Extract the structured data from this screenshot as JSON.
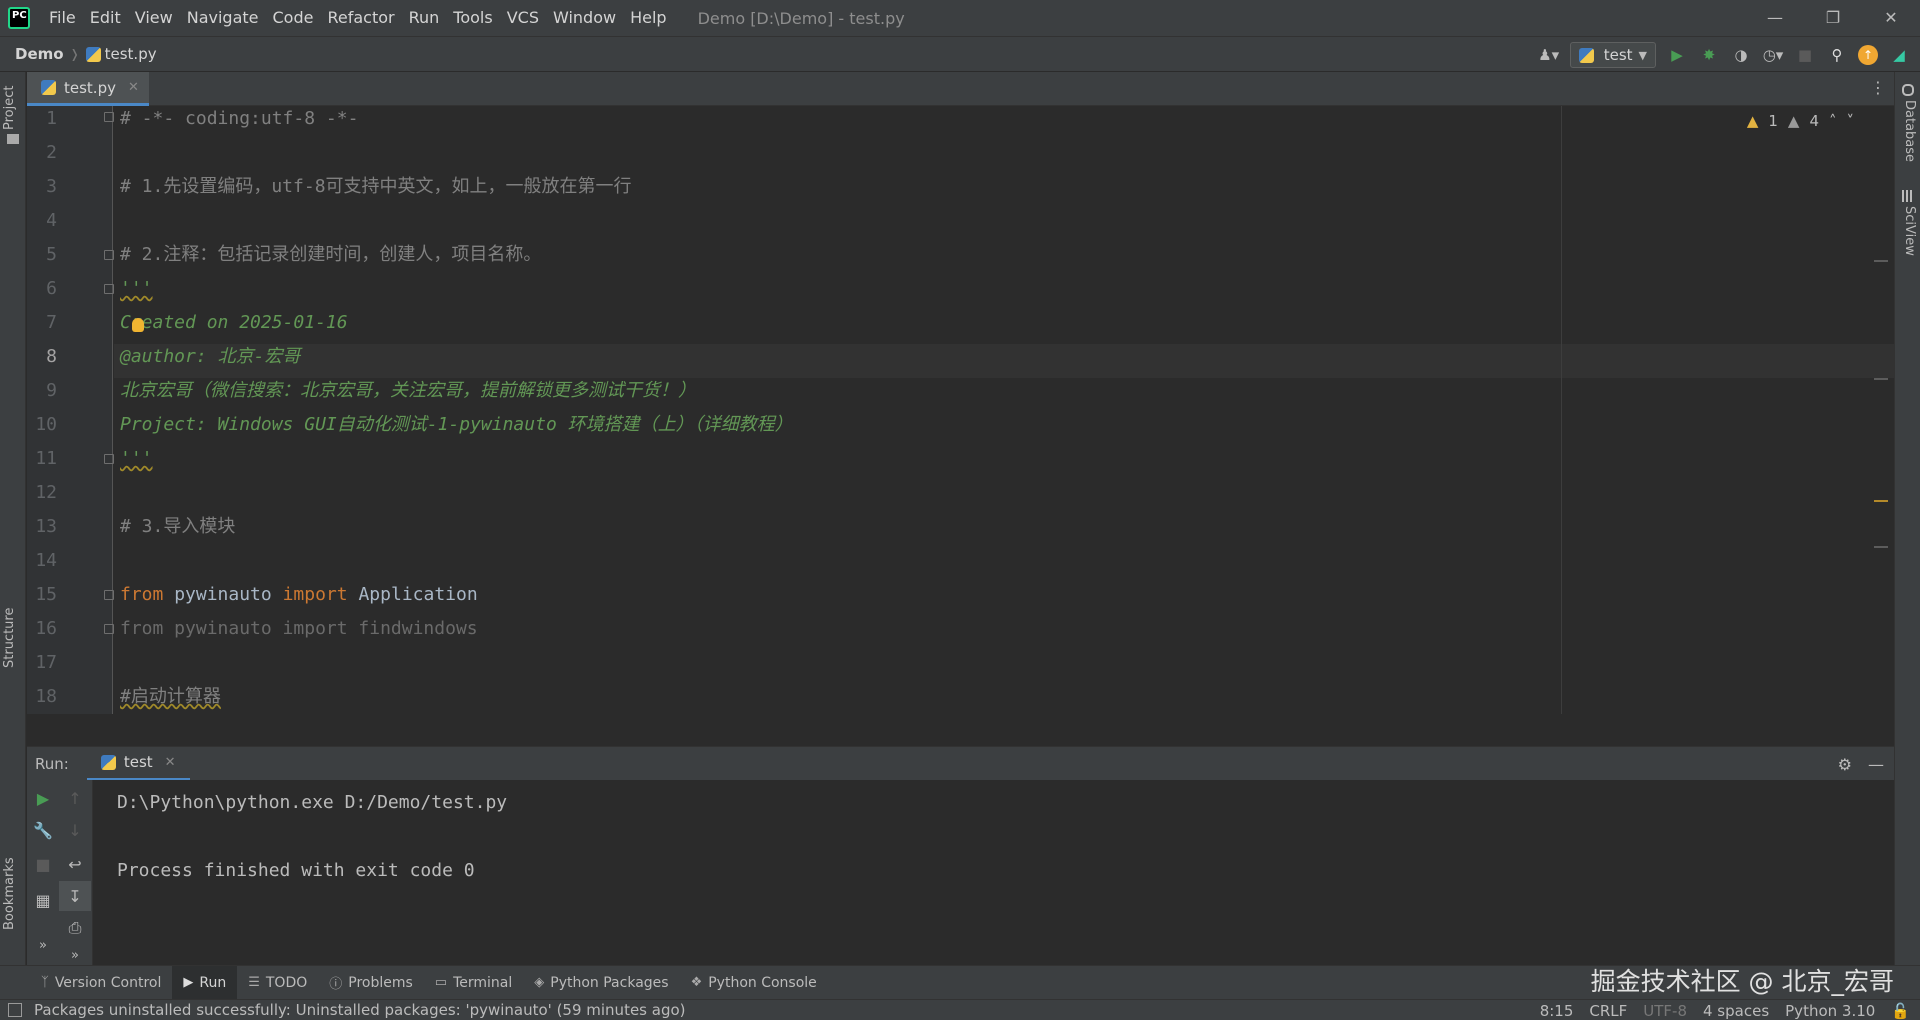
{
  "titlebar": {
    "menu": [
      "File",
      "Edit",
      "View",
      "Navigate",
      "Code",
      "Refactor",
      "Run",
      "Tools",
      "VCS",
      "Window",
      "Help"
    ],
    "window_title": "Demo [D:\\Demo] - test.py"
  },
  "navbar": {
    "project": "Demo",
    "file": "test.py",
    "run_config": "test"
  },
  "left_strip": {
    "project": "Project",
    "structure": "Structure",
    "bookmarks": "Bookmarks"
  },
  "right_strip": {
    "database": "Database",
    "sciview": "SciView"
  },
  "editor_tab": {
    "label": "test.py"
  },
  "inspections": {
    "warnings": "1",
    "weak_warnings": "4"
  },
  "editor": {
    "current_line": 8,
    "lines": [
      {
        "n": "1",
        "text": "# -*- coding:utf-8 -*-"
      },
      {
        "n": "2",
        "text": ""
      },
      {
        "n": "3",
        "text": "# 1.先设置编码，utf-8可支持中英文，如上，一般放在第一行"
      },
      {
        "n": "4",
        "text": ""
      },
      {
        "n": "5",
        "text": "# 2.注释：包括记录创建时间，创建人，项目名称。"
      },
      {
        "n": "6",
        "text": "'''"
      },
      {
        "n": "7",
        "text": "Created on 2025-01-16"
      },
      {
        "n": "8",
        "text": "@author: 北京-宏哥"
      },
      {
        "n": "9",
        "text": "北京宏哥（微信搜索：北京宏哥，关注宏哥，提前解锁更多测试干货！）"
      },
      {
        "n": "10",
        "text": "Project: Windows GUI自动化测试-1-pywinauto 环境搭建（上）（详细教程）"
      },
      {
        "n": "11",
        "text": "'''"
      },
      {
        "n": "12",
        "text": ""
      },
      {
        "n": "13",
        "text": "# 3.导入模块"
      },
      {
        "n": "14",
        "text": ""
      },
      {
        "n": "15",
        "kw1": "from",
        "mod": "pywinauto",
        "kw2": "import",
        "name": "Application"
      },
      {
        "n": "16",
        "text": "from pywinauto import findwindows"
      },
      {
        "n": "17",
        "text": ""
      },
      {
        "n": "18",
        "text": "#启动计算器"
      }
    ]
  },
  "run_panel": {
    "label": "Run:",
    "tab": "test",
    "output": [
      "D:\\Python\\python.exe D:/Demo/test.py",
      "",
      "Process finished with exit code 0"
    ]
  },
  "tool_windows": [
    {
      "label": "Version Control",
      "icon": "branch-icon"
    },
    {
      "label": "Run",
      "icon": "run-icon"
    },
    {
      "label": "TODO",
      "icon": "list-icon"
    },
    {
      "label": "Problems",
      "icon": "info-icon"
    },
    {
      "label": "Terminal",
      "icon": "terminal-icon"
    },
    {
      "label": "Python Packages",
      "icon": "layers-icon"
    },
    {
      "label": "Python Console",
      "icon": "python-icon"
    }
  ],
  "watermark": "掘金技术社区 @ 北京_宏哥",
  "statusbar": {
    "message": "Packages uninstalled successfully: Uninstalled packages: 'pywinauto' (59 minutes ago)",
    "position": "8:15",
    "line_sep": "CRLF",
    "encoding": "UTF-8",
    "indent": "4 spaces",
    "interpreter": "Python 3.10"
  }
}
